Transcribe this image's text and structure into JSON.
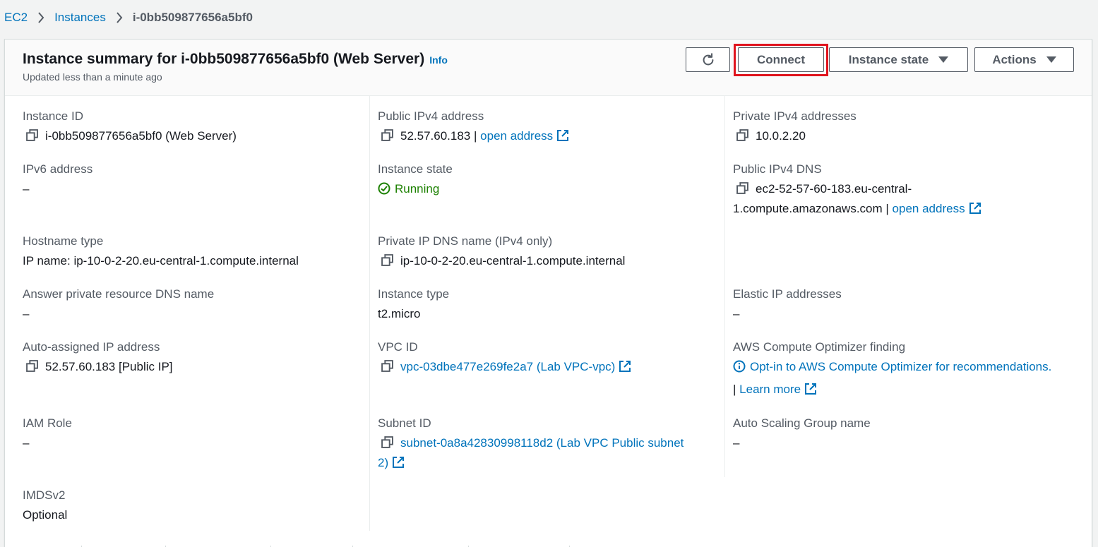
{
  "breadcrumb": {
    "items": [
      "EC2",
      "Instances"
    ],
    "current": "i-0bb509877656a5bf0"
  },
  "header": {
    "title": "Instance summary for i-0bb509877656a5bf0 (Web Server)",
    "info_label": "Info",
    "subtitle": "Updated less than a minute ago",
    "refresh_icon": "refresh-icon",
    "connect_label": "Connect",
    "instance_state_label": "Instance state",
    "actions_label": "Actions",
    "highlight_color": "#e0141e"
  },
  "fields": {
    "instance_id": {
      "label": "Instance ID",
      "value": "i-0bb509877656a5bf0 (Web Server)"
    },
    "public_ipv4": {
      "label": "Public IPv4 address",
      "value": "52.57.60.183",
      "sep": "|",
      "link": "open address"
    },
    "private_ipv4": {
      "label": "Private IPv4 addresses",
      "value": "10.0.2.20"
    },
    "ipv6": {
      "label": "IPv6 address",
      "value": "–"
    },
    "instance_state": {
      "label": "Instance state",
      "value": "Running",
      "color": "#1d8102"
    },
    "public_dns": {
      "label": "Public IPv4 DNS",
      "value_line1": "ec2-52-57-60-183.eu-central-",
      "value_line2": "1.compute.amazonaws.com",
      "sep": "|",
      "link": "open address"
    },
    "hostname_type": {
      "label": "Hostname type",
      "value": "IP name: ip-10-0-2-20.eu-central-1.compute.internal"
    },
    "private_dns": {
      "label": "Private IP DNS name (IPv4 only)",
      "value": "ip-10-0-2-20.eu-central-1.compute.internal"
    },
    "answer_dns": {
      "label": "Answer private resource DNS name",
      "value": "–"
    },
    "instance_type": {
      "label": "Instance type",
      "value": "t2.micro"
    },
    "elastic_ip": {
      "label": "Elastic IP addresses",
      "value": "–"
    },
    "auto_ip": {
      "label": "Auto-assigned IP address",
      "value": "52.57.60.183 [Public IP]"
    },
    "vpc_id": {
      "label": "VPC ID",
      "value": "vpc-03dbe477e269fe2a7 (Lab VPC-vpc)"
    },
    "optimizer": {
      "label": "AWS Compute Optimizer finding",
      "link": "Opt-in to AWS Compute Optimizer for recommendations.",
      "sep": "|",
      "learn_more": "Learn more"
    },
    "iam_role": {
      "label": "IAM Role",
      "value": "–"
    },
    "subnet_id": {
      "label": "Subnet ID",
      "value_line1": "subnet-0a8a42830998118d2 (Lab VPC Public subnet",
      "value_line2": "2)"
    },
    "asg_name": {
      "label": "Auto Scaling Group name",
      "value": "–"
    },
    "imdsv2": {
      "label": "IMDSv2",
      "value": "Optional"
    }
  }
}
